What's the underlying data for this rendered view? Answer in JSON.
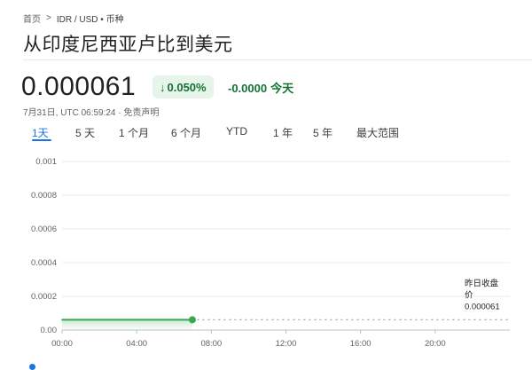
{
  "breadcrumb": {
    "home": "首页",
    "current": "IDR / USD • 币种"
  },
  "title": "从印度尼西亚卢比到美元",
  "quote": {
    "price": "0.000061",
    "change_percent": "0.050%",
    "change_abs": "-0.0000",
    "period": "今天",
    "timestamp": "7月31日, UTC 06:59:24 · 免责声明"
  },
  "tabs": [
    {
      "label": "1天",
      "active": true
    },
    {
      "label": "5 天",
      "active": false
    },
    {
      "label": "1 个月",
      "active": false
    },
    {
      "label": "6 个月",
      "active": false
    },
    {
      "label": "YTD",
      "active": false
    },
    {
      "label": "1 年",
      "active": false
    },
    {
      "label": "5 年",
      "active": false
    },
    {
      "label": "最大范围",
      "active": false
    }
  ],
  "colors": {
    "accent": "#1a73e8",
    "positive": "#137333",
    "line": "#34a853",
    "chip_bg": "#e6f4ea"
  },
  "chart_data": {
    "type": "line",
    "x_ticks": [
      "00:00",
      "04:00",
      "08:00",
      "12:00",
      "16:00",
      "20:00"
    ],
    "y_ticks": [
      "0.001",
      "0.0008",
      "0.0006",
      "0.0004",
      "0.0002",
      "0.00"
    ],
    "ylim": [
      0,
      0.001
    ],
    "xlim_hours": [
      0,
      24
    ],
    "series": [
      {
        "x": [
          "00:00",
          "01:00",
          "02:00",
          "03:00",
          "04:00",
          "05:00",
          "06:00",
          "06:59"
        ],
        "values": [
          6.1e-05,
          6.1e-05,
          6.1e-05,
          6.1e-05,
          6.1e-05,
          6.1e-05,
          6.1e-05,
          6.1e-05
        ]
      }
    ],
    "reference_line": {
      "value": 6.1e-05,
      "label_lines": [
        "昨日收盘",
        "价"
      ],
      "value_label": "0.000061"
    },
    "grid": true
  }
}
